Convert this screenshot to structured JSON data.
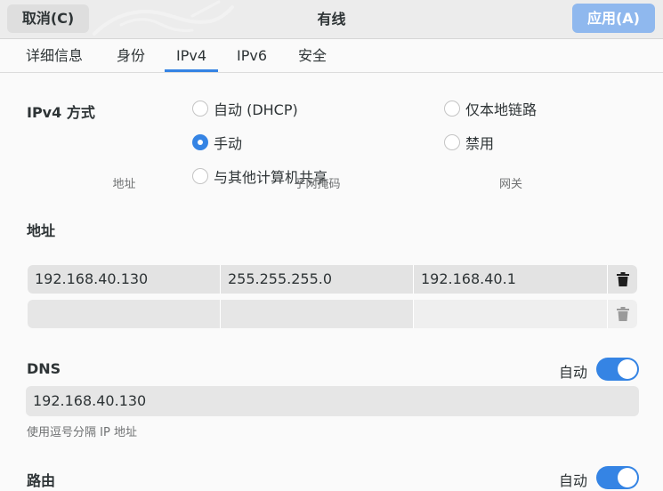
{
  "header": {
    "cancel_label": "取消(C)",
    "title": "有线",
    "apply_label": "应用(A)"
  },
  "tabs": [
    {
      "label": "详细信息"
    },
    {
      "label": "身份"
    },
    {
      "label": "IPv4",
      "active": true
    },
    {
      "label": "IPv6"
    },
    {
      "label": "安全"
    }
  ],
  "ipv4_method": {
    "title": "IPv4 方式",
    "options": [
      {
        "label": "自动 (DHCP)",
        "checked": false
      },
      {
        "label": "仅本地链路",
        "checked": false
      },
      {
        "label": "手动",
        "checked": true
      },
      {
        "label": "禁用",
        "checked": false
      },
      {
        "label": "与其他计算机共享",
        "checked": false
      }
    ]
  },
  "addresses": {
    "title": "地址",
    "columns": [
      "地址",
      "子网掩码",
      "网关"
    ],
    "rows": [
      [
        "192.168.40.130",
        "255.255.255.0",
        "192.168.40.1"
      ],
      [
        "",
        "",
        ""
      ]
    ]
  },
  "dns": {
    "title": "DNS",
    "auto_label": "自动",
    "auto_enabled": true,
    "value": "192.168.40.130",
    "hint": "使用逗号分隔 IP 地址"
  },
  "routes": {
    "title": "路由",
    "auto_label": "自动",
    "auto_enabled": true
  },
  "colors": {
    "accent": "#3584e4",
    "apply_button": "#8fb8ee"
  }
}
